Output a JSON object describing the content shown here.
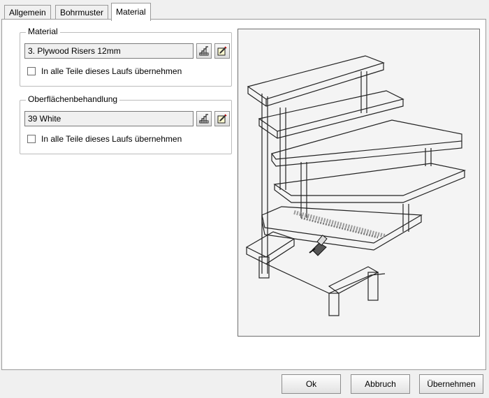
{
  "tabs": [
    {
      "label": "Allgemein"
    },
    {
      "label": "Bohrmuster"
    },
    {
      "label": "Material"
    }
  ],
  "active_tab": "Material",
  "material_group": {
    "title": "Material",
    "value": "3. Plywood Risers 12mm",
    "checkbox_label": "In alle Teile dieses Laufs übernehmen",
    "checked": false
  },
  "surface_group": {
    "title": "Oberflächenbehandlung",
    "value": "39 White",
    "checkbox_label": "In alle Teile dieses Laufs übernehmen",
    "checked": false
  },
  "icons": {
    "library": "stair-library-icon",
    "edit": "edit-pencil-icon",
    "preview": "stair-wireframe-preview"
  },
  "buttons": {
    "ok": "Ok",
    "cancel": "Abbruch",
    "apply": "Übernehmen"
  }
}
